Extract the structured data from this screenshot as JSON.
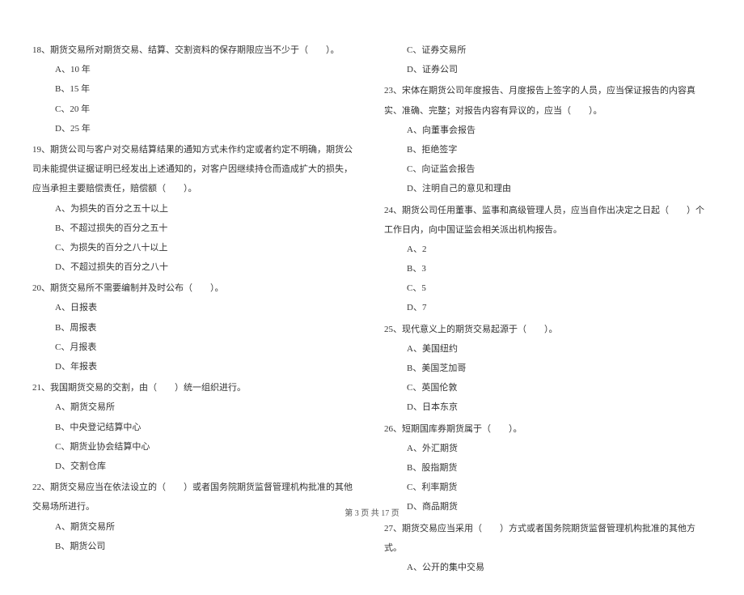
{
  "left_column": {
    "q18": {
      "text": "18、期货交易所对期货交易、结算、交割资料的保存期限应当不少于（　　）。",
      "options": [
        "A、10 年",
        "B、15 年",
        "C、20 年",
        "D、25 年"
      ]
    },
    "q19": {
      "text": "19、期货公司与客户对交易结算结果的通知方式未作约定或者约定不明确，期货公司未能提供证据证明已经发出上述通知的，对客户因继续持仓而造成扩大的损失，应当承担主要赔偿责任，赔偿额（　　）。",
      "options": [
        "A、为损失的百分之五十以上",
        "B、不超过损失的百分之五十",
        "C、为损失的百分之八十以上",
        "D、不超过损失的百分之八十"
      ]
    },
    "q20": {
      "text": "20、期货交易所不需要编制并及时公布（　　）。",
      "options": [
        "A、日报表",
        "B、周报表",
        "C、月报表",
        "D、年报表"
      ]
    },
    "q21": {
      "text": "21、我国期货交易的交割，由（　　）统一组织进行。",
      "options": [
        "A、期货交易所",
        "B、中央登记结算中心",
        "C、期货业协会结算中心",
        "D、交割仓库"
      ]
    },
    "q22": {
      "text": "22、期货交易应当在依法设立的（　　）或者国务院期货监督管理机构批准的其他交易场所进行。",
      "options": [
        "A、期货交易所",
        "B、期货公司"
      ]
    }
  },
  "right_column": {
    "q22_cont": {
      "options": [
        "C、证券交易所",
        "D、证券公司"
      ]
    },
    "q23": {
      "text": "23、宋体在期货公司年度报告、月度报告上签字的人员，应当保证报告的内容真实、准确、完整；对报告内容有异议的，应当（　　）。",
      "options": [
        "A、向董事会报告",
        "B、拒绝签字",
        "C、向证监会报告",
        "D、注明自己的意见和理由"
      ]
    },
    "q24": {
      "text": "24、期货公司任用董事、监事和高级管理人员，应当自作出决定之日起（　　）个工作日内，向中国证监会相关派出机构报告。",
      "options": [
        "A、2",
        "B、3",
        "C、5",
        "D、7"
      ]
    },
    "q25": {
      "text": "25、现代意义上的期货交易起源于（　　）。",
      "options": [
        "A、美国纽约",
        "B、美国芝加哥",
        "C、英国伦敦",
        "D、日本东京"
      ]
    },
    "q26": {
      "text": "26、短期国库券期货属于（　　）。",
      "options": [
        "A、外汇期货",
        "B、股指期货",
        "C、利率期货",
        "D、商品期货"
      ]
    },
    "q27": {
      "text": "27、期货交易应当采用（　　）方式或者国务院期货监督管理机构批准的其他方式。",
      "options": [
        "A、公开的集中交易"
      ]
    }
  },
  "footer": "第 3 页 共 17 页"
}
